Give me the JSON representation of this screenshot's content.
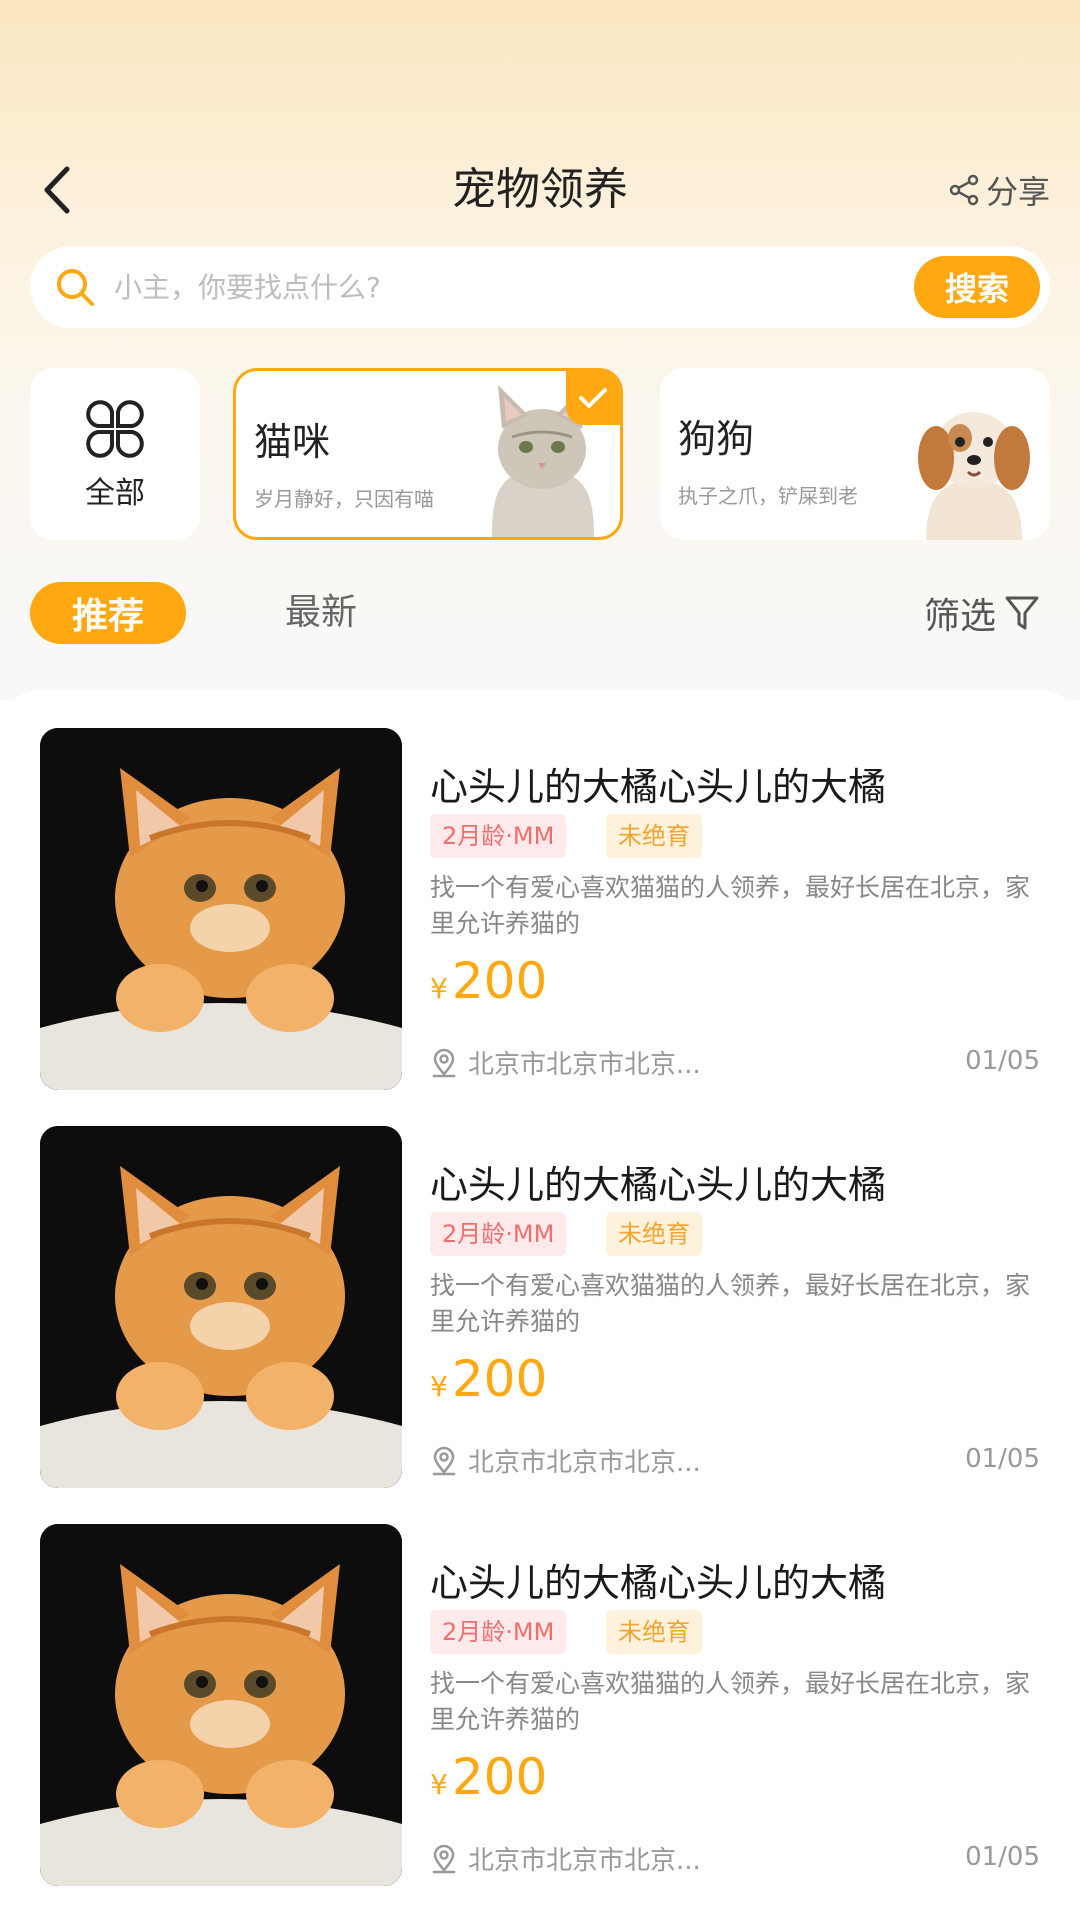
{
  "header": {
    "title": "宠物领养",
    "share_label": "分享"
  },
  "search": {
    "placeholder": "小主，你要找点什么?",
    "button_label": "搜索"
  },
  "categories": {
    "all_label": "全部",
    "cards": [
      {
        "title": "猫咪",
        "desc": "岁月静好，只因有喵",
        "selected": true
      },
      {
        "title": "狗狗",
        "desc": "执子之爪，铲屎到老",
        "selected": false
      }
    ]
  },
  "tabs": {
    "recommend": "推荐",
    "latest": "最新",
    "filter": "筛选"
  },
  "items": [
    {
      "title": "心头儿的大橘心头儿的大橘",
      "tag_age": "2月龄·MM",
      "tag_status": "未绝育",
      "desc": "找一个有爱心喜欢猫猫的人领养，最好长居在北京，家里允许养猫的",
      "currency": "¥",
      "price": "200",
      "location": "北京市北京市北京...",
      "date": "01/05"
    },
    {
      "title": "心头儿的大橘心头儿的大橘",
      "tag_age": "2月龄·MM",
      "tag_status": "未绝育",
      "desc": "找一个有爱心喜欢猫猫的人领养，最好长居在北京，家里允许养猫的",
      "currency": "¥",
      "price": "200",
      "location": "北京市北京市北京...",
      "date": "01/05"
    },
    {
      "title": "心头儿的大橘心头儿的大橘",
      "tag_age": "2月龄·MM",
      "tag_status": "未绝育",
      "desc": "找一个有爱心喜欢猫猫的人领养，最好长居在北京，家里允许养猫的",
      "currency": "¥",
      "price": "200",
      "location": "北京市北京市北京...",
      "date": "01/05"
    }
  ],
  "colors": {
    "accent": "#ffa811",
    "tag_age_text": "#ef6e6e",
    "tag_status_text": "#f0a530"
  }
}
